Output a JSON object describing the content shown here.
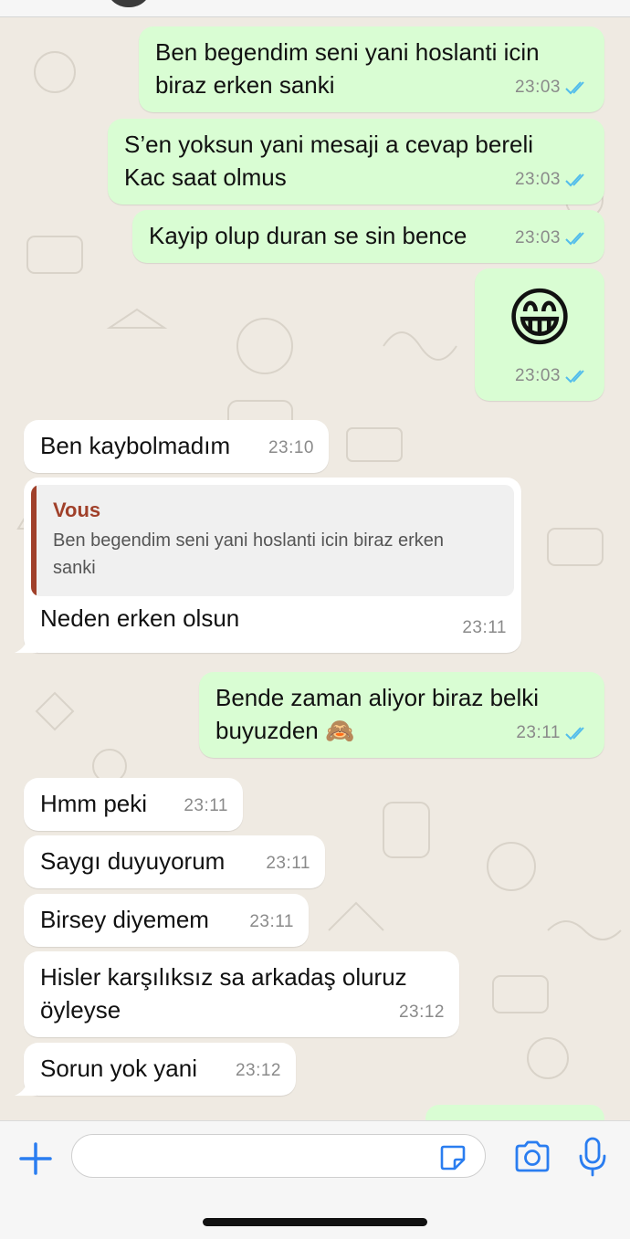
{
  "colors": {
    "outgoing_bubble": "#d9fdd3",
    "incoming_bubble": "#ffffff",
    "chat_background": "#efeae2",
    "read_ticks": "#53bdeb",
    "quote_accent": "#a0402a",
    "icon_blue": "#2a7df0"
  },
  "messages": [
    {
      "dir": "out",
      "text": "Ben begendim seni yani hoslanti icin\nbiraz erken sanki",
      "time": "23:03",
      "status": "read"
    },
    {
      "dir": "out",
      "text": "S’en yoksun yani mesaji a cevap bereli\nKac saat olmus",
      "time": "23:03",
      "status": "read"
    },
    {
      "dir": "out",
      "text": "Kayip olup duran se sin bence",
      "time": "23:03",
      "status": "read"
    },
    {
      "dir": "out",
      "text": "😁",
      "time": "23:03",
      "status": "read"
    },
    {
      "dir": "in",
      "text": "Ben kaybolmadım",
      "time": "23:10"
    },
    {
      "dir": "in",
      "quote": {
        "author": "Vous",
        "text": "Ben begendim seni yani hoslanti icin biraz erken\nsanki"
      },
      "text": "Neden erken olsun",
      "time": "23:11"
    },
    {
      "dir": "out",
      "text": "Bende zaman aliyor biraz belki\nbuyuzden 🙈",
      "time": "23:11",
      "status": "read"
    },
    {
      "dir": "in",
      "text": "Hmm peki",
      "time": "23:11"
    },
    {
      "dir": "in",
      "text": "Saygı duyuyorum",
      "time": "23:11"
    },
    {
      "dir": "in",
      "text": "Birsey diyemem",
      "time": "23:11"
    },
    {
      "dir": "in",
      "text": "Hisler karşılıksız sa arkadaş oluruz\nöyleyse",
      "time": "23:12"
    },
    {
      "dir": "in",
      "text": "Sorun yok yani",
      "time": "23:12"
    }
  ],
  "composer": {
    "input_value": "",
    "icons": [
      "plus-icon",
      "sticker-icon",
      "camera-icon",
      "microphone-icon"
    ]
  }
}
